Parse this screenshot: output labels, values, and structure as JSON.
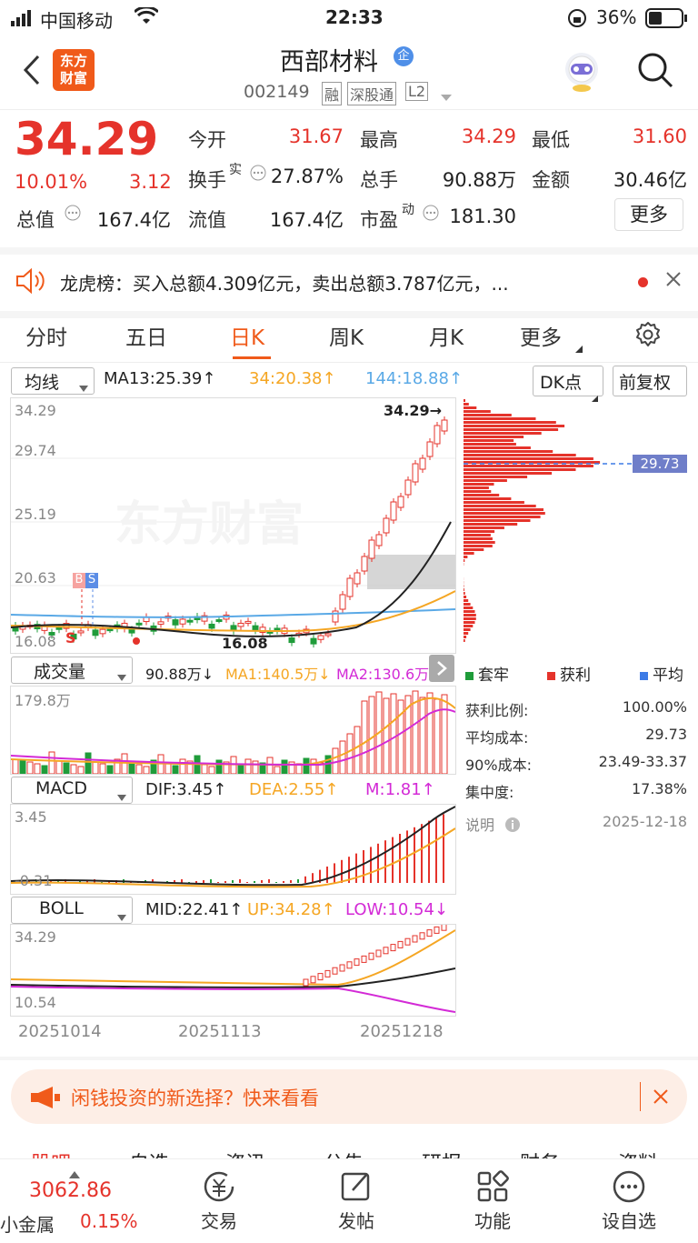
{
  "status": {
    "carrier": "中国移动",
    "time": "22:33",
    "battery": "36%"
  },
  "header": {
    "logo_line1": "东方",
    "logo_line2": "财富",
    "title": "西部材料",
    "badge": "企",
    "code": "002149",
    "tag1": "融",
    "tag2": "深股通",
    "tag3": "L2"
  },
  "quote": {
    "price": "34.29",
    "pct": "10.01%",
    "change": "3.12",
    "open_lbl": "今开",
    "open": "31.67",
    "high_lbl": "最高",
    "high": "34.29",
    "low_lbl": "最低",
    "low": "31.60",
    "turnover_lbl": "换手",
    "turnover_sup": "实",
    "turnover": "27.87%",
    "vol_lbl": "总手",
    "vol": "90.88万",
    "amt_lbl": "金额",
    "amt": "30.46亿",
    "mcap_lbl": "总值",
    "mcap": "167.4亿",
    "float_lbl": "流值",
    "float": "167.4亿",
    "pe_lbl": "市盈",
    "pe_sup": "动",
    "pe": "181.30",
    "more": "更多"
  },
  "news": {
    "text": "龙虎榜：买入总额4.309亿元，卖出总额3.787亿元，..."
  },
  "tabs": [
    "分时",
    "五日",
    "日K",
    "周K",
    "月K",
    "更多"
  ],
  "main_ind": {
    "name": "均线",
    "ma13": "MA13:25.39↑",
    "ma34": "34:20.38↑",
    "ma144": "144:18.88↑",
    "dk": "DK点",
    "adjust": "前复权"
  },
  "price_axis": {
    "top": "34.29",
    "l2": "29.74",
    "l3": "25.19",
    "l4": "20.63",
    "bottom": "16.08"
  },
  "annotations": {
    "high_mark": "34.29→",
    "low_mark": "16.08",
    "watermark": "东方财富",
    "B": "B",
    "S": "S",
    "S2": "S",
    "avg_cost": "29.73"
  },
  "vol_ind": {
    "name": "成交量",
    "vol": "90.88万↓",
    "ma1": "MA1:140.5万↓",
    "ma2": "MA2:130.6万↑",
    "axis": "179.8万"
  },
  "macd_ind": {
    "name": "MACD",
    "dif": "DIF:3.45↑",
    "dea": "DEA:2.55↑",
    "m": "M:1.81↑",
    "top": "3.45",
    "bottom": "-0.31"
  },
  "boll_ind": {
    "name": "BOLL",
    "mid": "MID:22.41↑",
    "up": "UP:34.28↑",
    "low": "LOW:10.54↓",
    "top": "34.29",
    "bottom": "10.54"
  },
  "dates": [
    "20251014",
    "20251113",
    "20251218"
  ],
  "chip": {
    "legend": [
      "套牢",
      "获利",
      "平均"
    ],
    "stats": [
      {
        "label": "获利比例:",
        "value": "100.00%"
      },
      {
        "label": "平均成本:",
        "value": "29.73"
      },
      {
        "label": "90%成本:",
        "value": "23.49-33.37"
      },
      {
        "label": "集中度:",
        "value": "17.38%"
      }
    ],
    "note": "说明",
    "date": "2025-12-18"
  },
  "ad": {
    "text": "闲钱投资的新选择？快来看看"
  },
  "sub_tabs": [
    "股吧",
    "自选",
    "资讯",
    "公告",
    "研报",
    "财务",
    "资料"
  ],
  "bottom": {
    "index_value": "3062.86",
    "index_name": "小金属",
    "index_pct": "0.15%",
    "nav": [
      "交易",
      "发帖",
      "功能",
      "设自选"
    ]
  },
  "colors": {
    "up": "#e5332b",
    "down": "#1f9c3a",
    "ma13": "#222222",
    "ma34": "#f5a623",
    "ma144": "#5aa9e6",
    "accent": "#f05a1a"
  }
}
